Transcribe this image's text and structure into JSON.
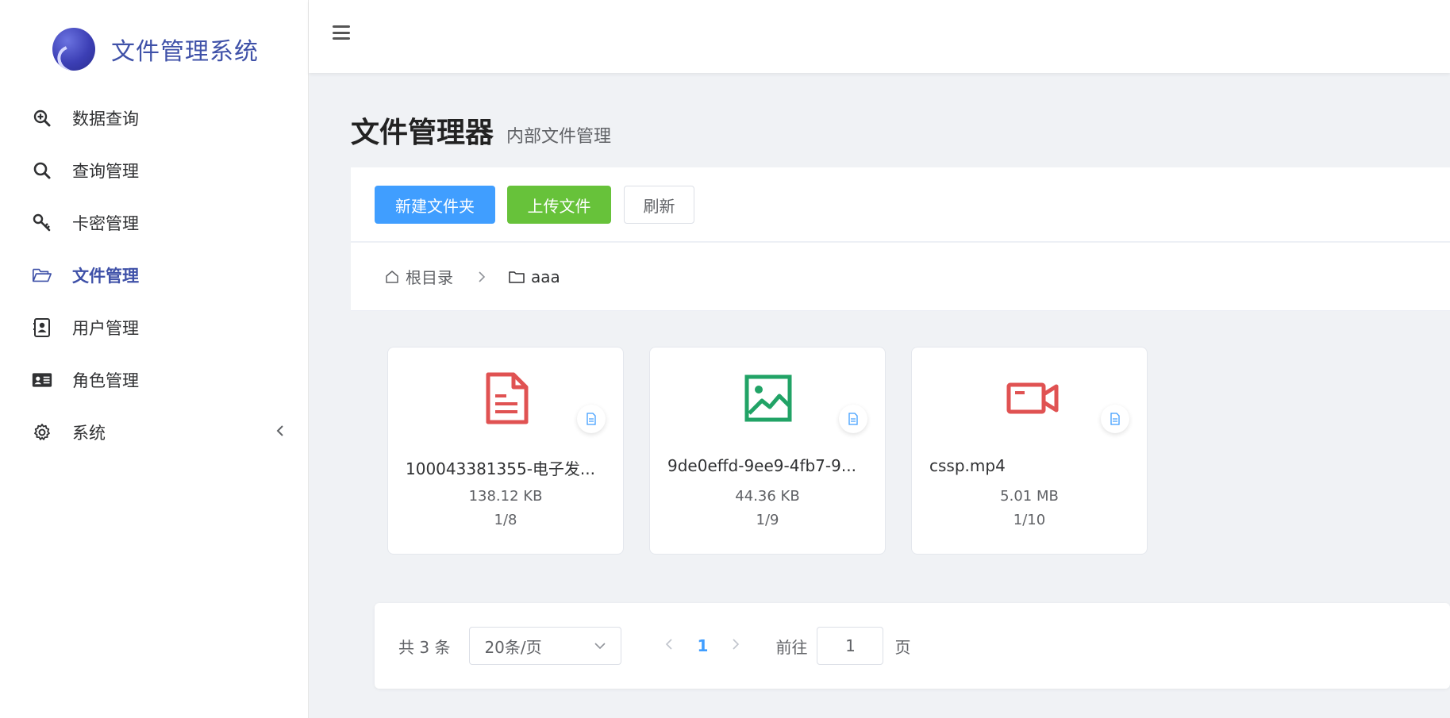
{
  "app": {
    "title": "文件管理系统"
  },
  "sidebar": {
    "items": [
      {
        "label": "数据查询",
        "icon": "zoom-in-icon"
      },
      {
        "label": "查询管理",
        "icon": "search-icon"
      },
      {
        "label": "卡密管理",
        "icon": "key-icon"
      },
      {
        "label": "文件管理",
        "icon": "folder-open-icon",
        "active": true
      },
      {
        "label": "用户管理",
        "icon": "user-contact-icon"
      },
      {
        "label": "角色管理",
        "icon": "id-card-icon"
      },
      {
        "label": "系统",
        "icon": "gear-icon",
        "arrow": "chevron-left-icon"
      }
    ]
  },
  "header": {
    "title": "文件管理器",
    "subtitle": "内部文件管理"
  },
  "toolbar": {
    "new_folder_label": "新建文件夹",
    "upload_label": "上传文件",
    "refresh_label": "刷新"
  },
  "breadcrumb": {
    "root": "根目录",
    "current": "aaa"
  },
  "files": [
    {
      "name": "100043381355-电子发...",
      "size": "138.12 KB",
      "page": "1/8",
      "icon": "document-icon",
      "color": "#e05252"
    },
    {
      "name": "9de0effd-9ee9-4fb7-9...",
      "size": "44.36 KB",
      "page": "1/9",
      "icon": "image-icon",
      "color": "#21a366"
    },
    {
      "name": "cssp.mp4",
      "size": "5.01 MB",
      "page": "1/10",
      "icon": "video-icon",
      "color": "#e05252"
    }
  ],
  "pagination": {
    "total": "共 3 条",
    "page_size": "20条/页",
    "current_page": "1",
    "goto_label": "前往",
    "goto_value": "1",
    "goto_suffix": "页"
  },
  "colors": {
    "primary": "#409eff",
    "success": "#67c23a",
    "brand": "#3f51a8"
  }
}
